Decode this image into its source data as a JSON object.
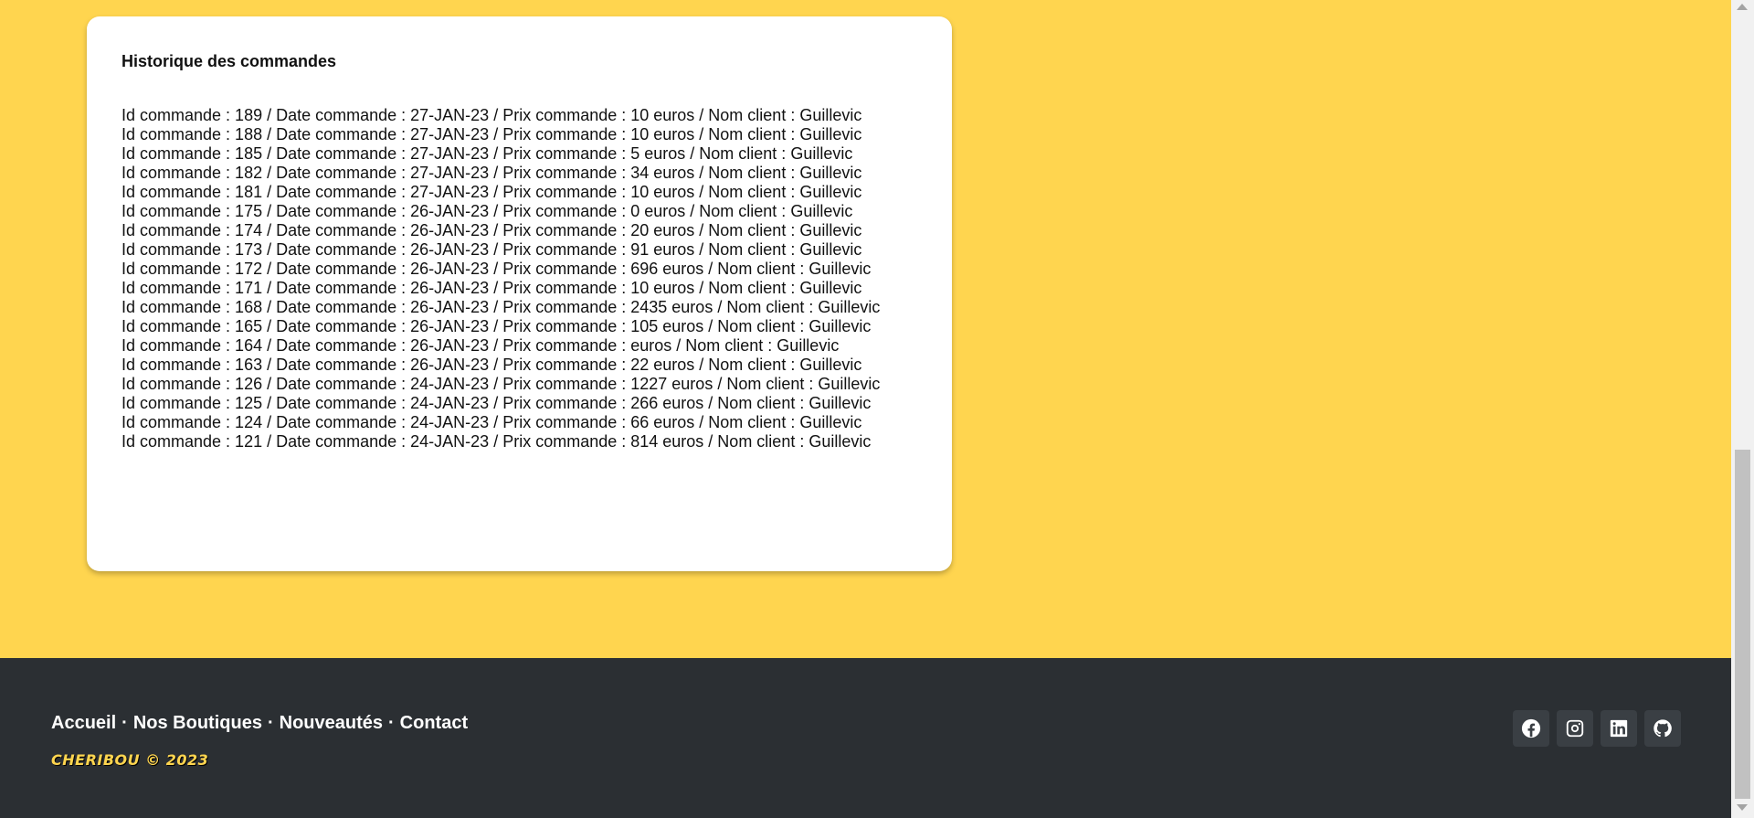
{
  "history": {
    "title": "Historique des commandes",
    "orders": [
      "Id commande : 189 / Date commande : 27-JAN-23 / Prix commande : 10 euros / Nom client : Guillevic",
      "Id commande : 188 / Date commande : 27-JAN-23 / Prix commande : 10 euros / Nom client : Guillevic",
      "Id commande : 185 / Date commande : 27-JAN-23 / Prix commande : 5 euros / Nom client : Guillevic",
      "Id commande : 182 / Date commande : 27-JAN-23 / Prix commande : 34 euros / Nom client : Guillevic",
      "Id commande : 181 / Date commande : 27-JAN-23 / Prix commande : 10 euros / Nom client : Guillevic",
      "Id commande : 175 / Date commande : 26-JAN-23 / Prix commande : 0 euros / Nom client : Guillevic",
      "Id commande : 174 / Date commande : 26-JAN-23 / Prix commande : 20 euros / Nom client : Guillevic",
      "Id commande : 173 / Date commande : 26-JAN-23 / Prix commande : 91 euros / Nom client : Guillevic",
      "Id commande : 172 / Date commande : 26-JAN-23 / Prix commande : 696 euros / Nom client : Guillevic",
      "Id commande : 171 / Date commande : 26-JAN-23 / Prix commande : 10 euros / Nom client : Guillevic",
      "Id commande : 168 / Date commande : 26-JAN-23 / Prix commande : 2435 euros / Nom client : Guillevic",
      "Id commande : 165 / Date commande : 26-JAN-23 / Prix commande : 105 euros / Nom client : Guillevic",
      "Id commande : 164 / Date commande : 26-JAN-23 / Prix commande : euros / Nom client : Guillevic",
      "Id commande : 163 / Date commande : 26-JAN-23 / Prix commande : 22 euros / Nom client : Guillevic",
      "Id commande : 126 / Date commande : 24-JAN-23 / Prix commande : 1227 euros / Nom client : Guillevic",
      "Id commande : 125 / Date commande : 24-JAN-23 / Prix commande : 266 euros / Nom client : Guillevic",
      "Id commande : 124 / Date commande : 24-JAN-23 / Prix commande : 66 euros / Nom client : Guillevic",
      "Id commande : 121 / Date commande : 24-JAN-23 / Prix commande : 814 euros / Nom client : Guillevic"
    ]
  },
  "footer": {
    "nav": [
      "Accueil",
      "Nos Boutiques",
      "Nouveautés",
      "Contact"
    ],
    "separator": "·",
    "brand": "CHERIBOU © 2023",
    "socials": [
      "facebook-icon",
      "instagram-icon",
      "linkedin-icon",
      "github-icon"
    ]
  },
  "colors": {
    "background": "#ffd54f",
    "card": "#ffffff",
    "footer": "#2b2f33",
    "brand": "#ffd54f"
  }
}
